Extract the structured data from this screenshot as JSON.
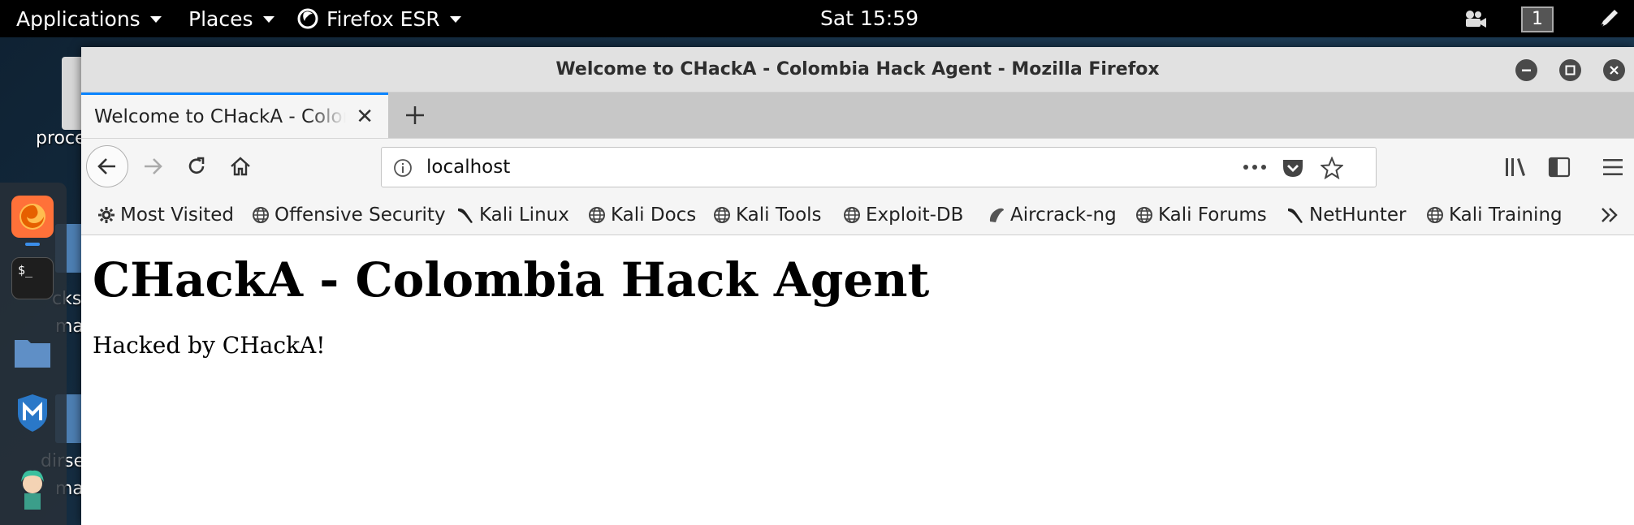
{
  "panel": {
    "applications": "Applications",
    "places": "Places",
    "browser": "Firefox ESR",
    "clock": "Sat 15:59",
    "workspace": "1"
  },
  "desktop": {
    "labels": [
      "proce",
      "cks",
      "ma",
      "dirse",
      "ma"
    ]
  },
  "window": {
    "title": "Welcome to CHackA - Colombia Hack Agent - Mozilla Firefox"
  },
  "tabs": [
    {
      "label": "Welcome to CHackA - Colombia Hack Agent"
    }
  ],
  "navbar": {
    "url": "localhost"
  },
  "bookmarks": [
    {
      "label": "Most Visited",
      "icon": "gear-icon"
    },
    {
      "label": "Offensive Security",
      "icon": "globe-icon"
    },
    {
      "label": "Kali Linux",
      "icon": "kali-dragon-icon"
    },
    {
      "label": "Kali Docs",
      "icon": "globe-icon"
    },
    {
      "label": "Kali Tools",
      "icon": "globe-icon"
    },
    {
      "label": "Exploit-DB",
      "icon": "globe-icon"
    },
    {
      "label": "Aircrack-ng",
      "icon": "aircrack-icon"
    },
    {
      "label": "Kali Forums",
      "icon": "globe-icon"
    },
    {
      "label": "NetHunter",
      "icon": "kali-dragon-icon"
    },
    {
      "label": "Kali Training",
      "icon": "globe-icon"
    }
  ],
  "page": {
    "heading": "CHackA - Colombia Hack Agent",
    "text": "Hacked by CHackA!"
  },
  "colors": {
    "accent": "#0a84ff",
    "panel_bg": "#000000",
    "titlebar_bg": "#e1e1e1"
  }
}
